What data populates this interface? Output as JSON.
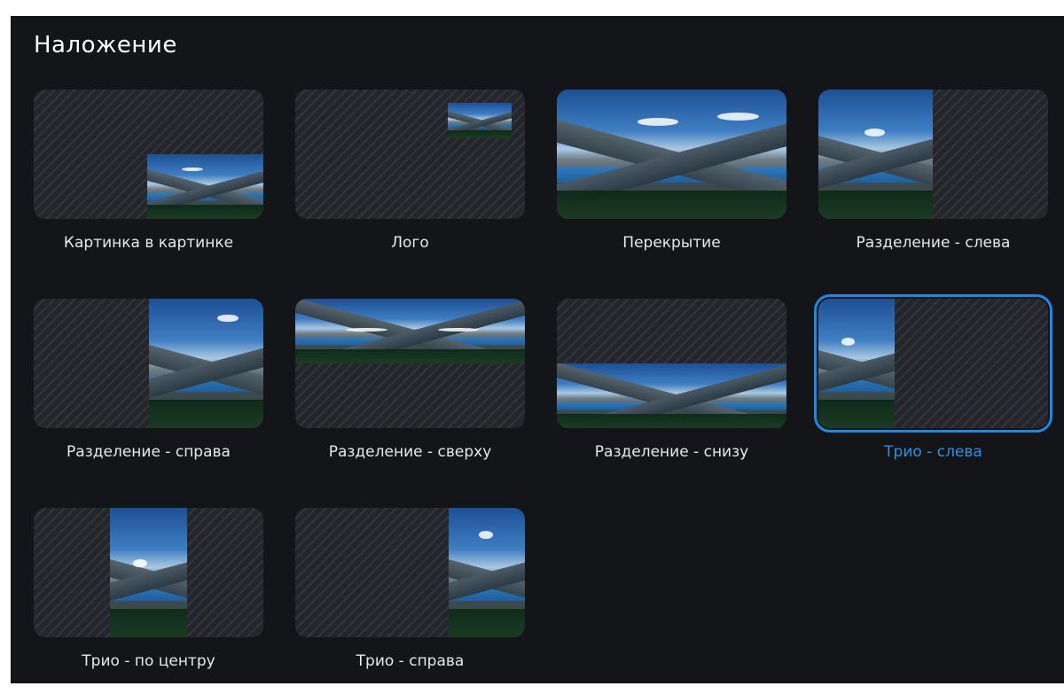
{
  "panel": {
    "title": "Наложение",
    "selected_color": "#1e88e8",
    "items": [
      {
        "label": "Картинка в картинке",
        "icon": "layout-picture-in-picture-icon",
        "selected": false
      },
      {
        "label": "Лого",
        "icon": "layout-logo-icon",
        "selected": false
      },
      {
        "label": "Перекрытие",
        "icon": "layout-overlay-icon",
        "selected": false
      },
      {
        "label": "Разделение - слева",
        "icon": "layout-split-left-icon",
        "selected": false
      },
      {
        "label": "Разделение - справа",
        "icon": "layout-split-right-icon",
        "selected": false
      },
      {
        "label": "Разделение - сверху",
        "icon": "layout-split-top-icon",
        "selected": false
      },
      {
        "label": "Разделение - снизу",
        "icon": "layout-split-bottom-icon",
        "selected": false
      },
      {
        "label": "Трио - слева",
        "icon": "layout-trio-left-icon",
        "selected": true
      },
      {
        "label": "Трио - по центру",
        "icon": "layout-trio-center-icon",
        "selected": false
      },
      {
        "label": "Трио - справа",
        "icon": "layout-trio-right-icon",
        "selected": false
      }
    ]
  }
}
